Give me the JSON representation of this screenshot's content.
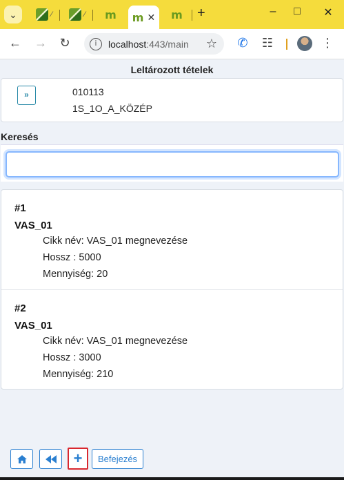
{
  "browser": {
    "tabs": [
      {
        "icon": "leaf-favicon",
        "label": "⁄"
      },
      {
        "icon": "leaf-favicon",
        "label": "⁄"
      },
      {
        "icon": "m-favicon",
        "label": ""
      },
      {
        "icon": "m-favicon",
        "label": "",
        "active": true
      },
      {
        "icon": "m-favicon",
        "label": ""
      }
    ],
    "tab_close": "✕",
    "new_tab": "+",
    "url_host": "localhost",
    "url_path": ":443/main"
  },
  "app": {
    "title": "Leltározott tételek",
    "location": {
      "code": "010113",
      "name": "1S_1O_A_KÖZÉP"
    },
    "search": {
      "label": "Keresés",
      "value": ""
    },
    "items": [
      {
        "num": "#1",
        "code": "VAS_01",
        "name_line": "Cikk név: VAS_01 megnevezése",
        "length_line": "Hossz : 5000",
        "qty_line": "Mennyiség: 20"
      },
      {
        "num": "#2",
        "code": "VAS_01",
        "name_line": "Cikk név: VAS_01 megnevezése",
        "length_line": "Hossz : 3000",
        "qty_line": "Mennyiség: 210"
      }
    ],
    "footer": {
      "finish_label": "Befejezés",
      "add_label": "+"
    }
  }
}
